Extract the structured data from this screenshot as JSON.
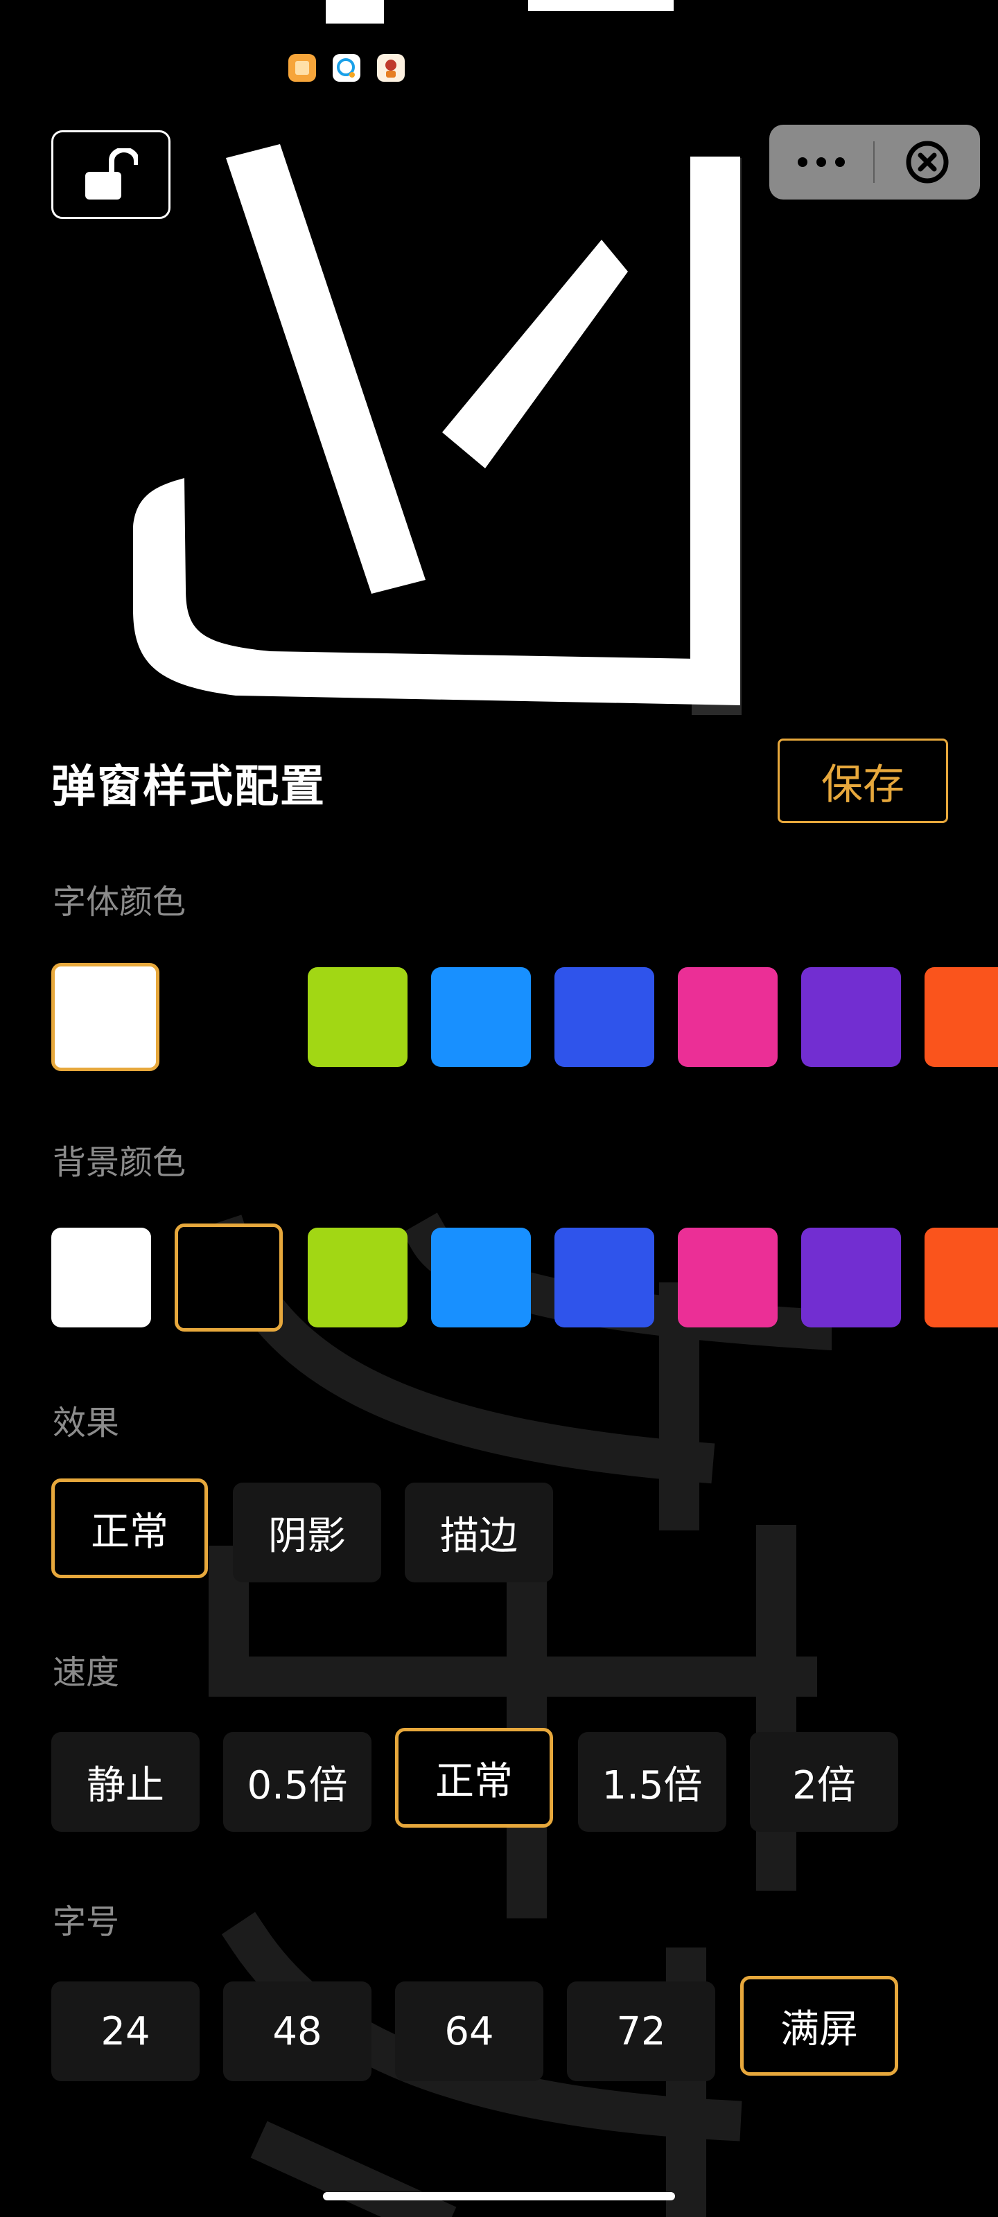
{
  "controls": {
    "lock_icon": "unlocked-padlock-icon",
    "more_icon": "more-dots-icon",
    "close_icon": "close-circle-icon"
  },
  "preview": {
    "text": "迎"
  },
  "panel": {
    "title": "弹窗样式配置",
    "save_label": "保存"
  },
  "font_color": {
    "label": "字体颜色",
    "swatches": [
      "#ffffff",
      "#000000",
      "#a2d714",
      "#1890ff",
      "#2f54eb",
      "#eb2f96",
      "#722ed1",
      "#fa541c"
    ],
    "selected": "#ffffff"
  },
  "bg_color": {
    "label": "背景颜色",
    "swatches": [
      "#ffffff",
      "#000000",
      "#a2d714",
      "#1890ff",
      "#2f54eb",
      "#eb2f96",
      "#722ed1",
      "#fa541c"
    ],
    "selected": "#000000"
  },
  "effect": {
    "label": "效果",
    "options": [
      "正常",
      "阴影",
      "描边"
    ],
    "selected": "正常"
  },
  "speed": {
    "label": "速度",
    "options": [
      "静止",
      "0.5倍",
      "正常",
      "1.5倍",
      "2倍"
    ],
    "selected": "正常"
  },
  "font_size": {
    "label": "字号",
    "options": [
      "24",
      "48",
      "64",
      "72",
      "满屏"
    ],
    "selected": "满屏"
  }
}
